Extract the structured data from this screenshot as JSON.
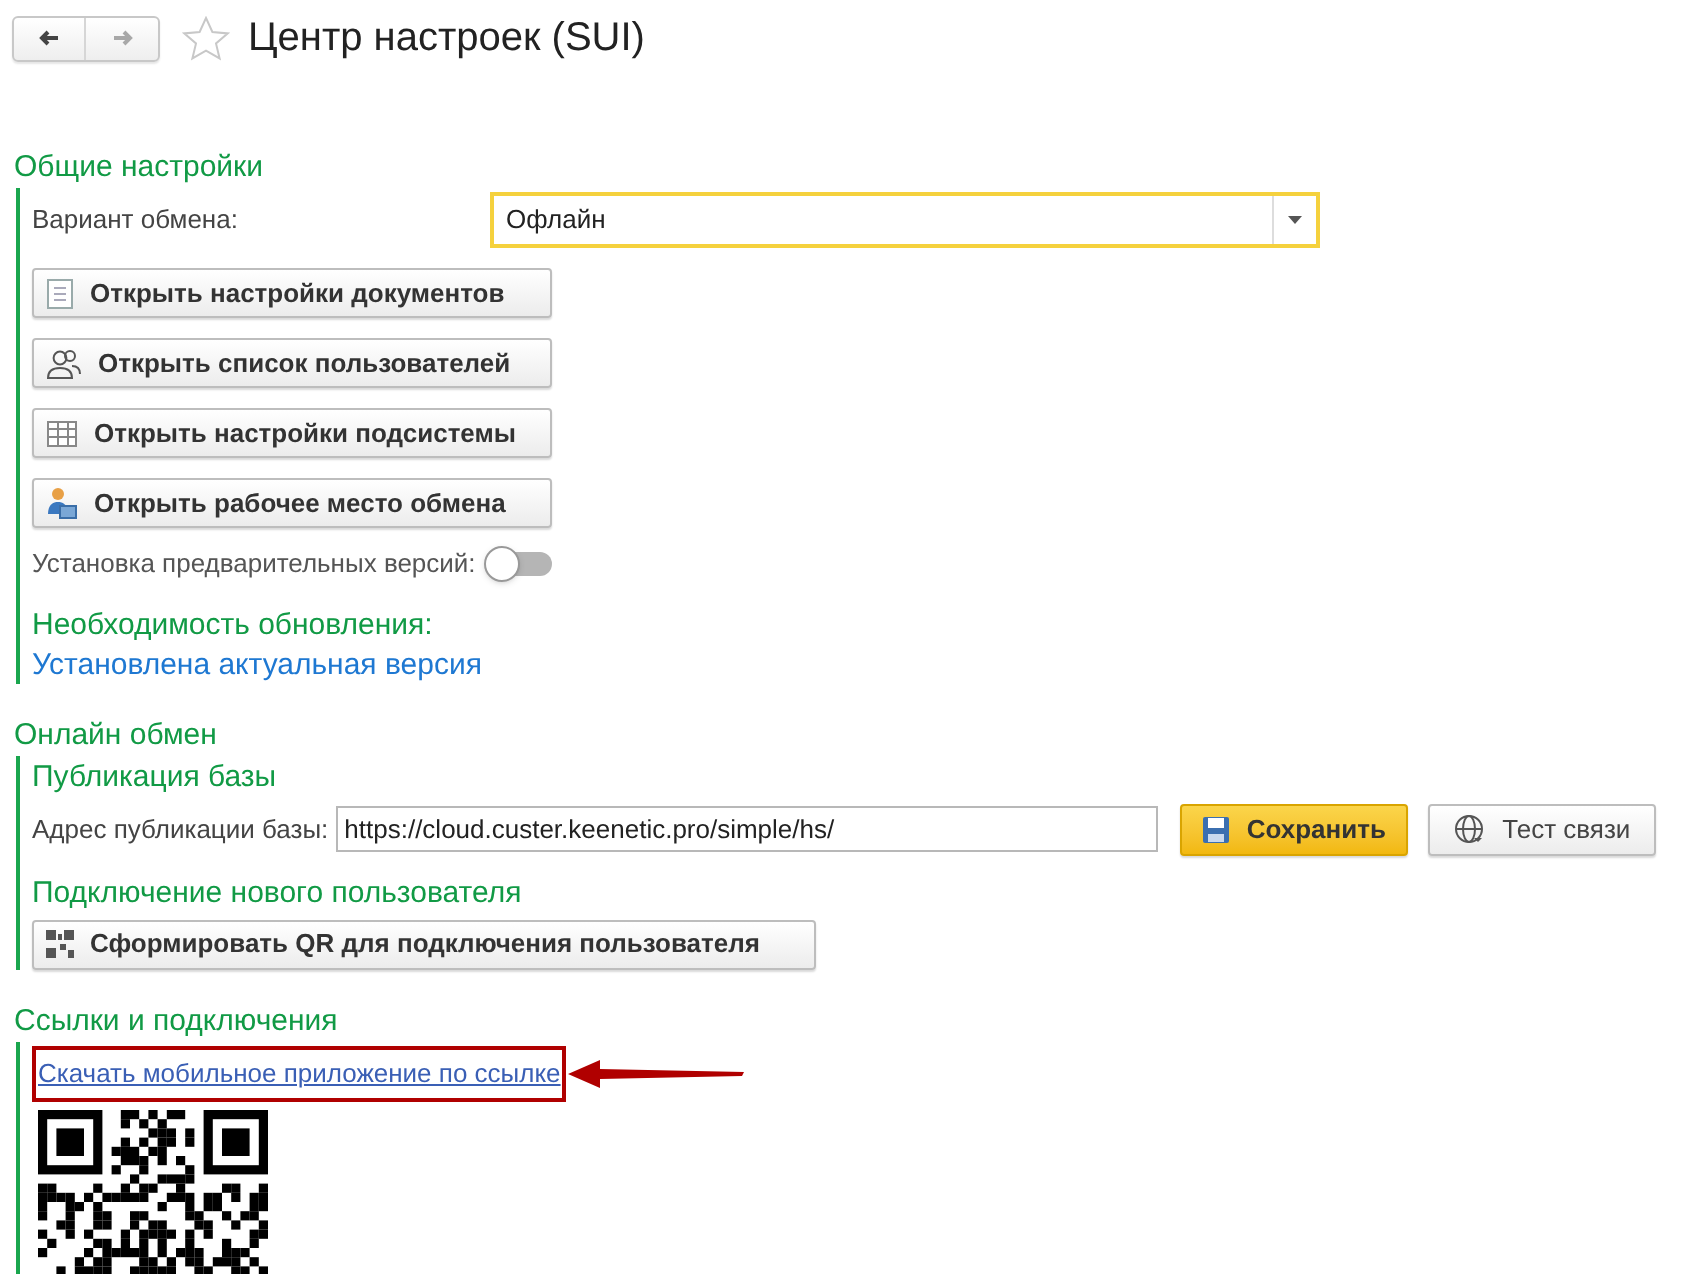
{
  "nav": {
    "back_disabled": false,
    "forward_disabled": true
  },
  "window": {
    "title": "Центр настроек (SUI)",
    "favorite": false
  },
  "sections": [
    {
      "title": "Общие настройки",
      "items": [
        {
          "kind": "select",
          "label": "Вариант обмена:",
          "value": "Офлайн",
          "focused": true
        },
        {
          "kind": "button",
          "label": "Открыть настройки документов"
        },
        {
          "kind": "button",
          "label": "Открыть список пользователей"
        },
        {
          "kind": "button",
          "label": "Открыть настройки подсистемы"
        },
        {
          "kind": "button",
          "label": "Открыть рабочее место обмена"
        },
        {
          "kind": "toggle",
          "label": "Установка предварительных версий:",
          "on": false
        },
        {
          "kind": "subheading",
          "text": "Необходимость обновления:"
        },
        {
          "kind": "status",
          "text": "Установлена актуальная версия"
        }
      ]
    },
    {
      "title": "Онлайн обмен",
      "items": [
        {
          "kind": "subheading",
          "text": "Публикация базы"
        },
        {
          "kind": "url",
          "label": "Адрес публикации базы:",
          "value": "https://cloud.custer.keenetic.pro/simple/hs/",
          "buttons": [
            {
              "label": "Сохранить",
              "primary": true
            },
            {
              "label": "Тест связи",
              "primary": false
            }
          ]
        },
        {
          "kind": "subheading",
          "text": "Подключение нового пользователя"
        },
        {
          "kind": "button",
          "label": "Сформировать QR для подключения пользователя",
          "wide": true
        }
      ]
    },
    {
      "title": "Ссылки и подключения",
      "items": [
        {
          "kind": "link",
          "text": "Скачать мобильное приложение по ссылке",
          "highlighted": true
        },
        {
          "kind": "qr"
        }
      ]
    }
  ]
}
